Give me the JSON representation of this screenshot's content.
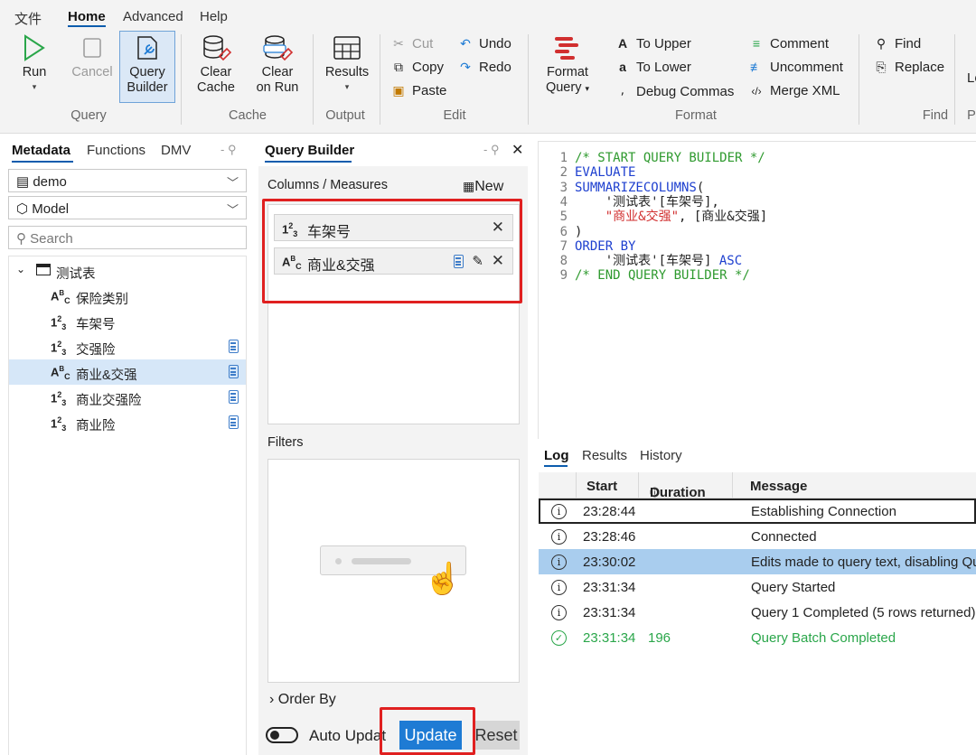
{
  "menubar": {
    "file": "文件",
    "home": "Home",
    "advanced": "Advanced",
    "help": "Help"
  },
  "ribbon": {
    "run": "Run",
    "cancel": "Cancel",
    "query_builder_l1": "Query",
    "query_builder_l2": "Builder",
    "clear_cache_l1": "Clear",
    "clear_cache_l2": "Cache",
    "clear_on_run_l1": "Clear",
    "clear_on_run_l2": "on Run",
    "results": "Results",
    "cut": "Cut",
    "copy": "Copy",
    "paste": "Paste",
    "undo": "Undo",
    "redo": "Redo",
    "format_query_l1": "Format",
    "format_query_l2": "Query",
    "to_upper": "To Upper",
    "to_lower": "To Lower",
    "debug_commas": "Debug Commas",
    "comment": "Comment",
    "uncomment": "Uncomment",
    "merge_xml": "Merge XML",
    "find": "Find",
    "replace": "Replace",
    "cut_off": "Lo",
    "groups": {
      "query": "Query",
      "cache": "Cache",
      "output": "Output",
      "edit": "Edit",
      "format": "Format",
      "find": "Find",
      "cut_off": "P"
    }
  },
  "metadata": {
    "tabs": [
      "Metadata",
      "Functions",
      "DMV"
    ],
    "database": "demo",
    "model": "Model",
    "search_placeholder": "Search",
    "table": "测试表",
    "columns": [
      {
        "type": "ABC",
        "name": "保险类别",
        "calc": false
      },
      {
        "type": "123",
        "name": "车架号",
        "calc": false
      },
      {
        "type": "123",
        "name": "交强险",
        "calc": true
      },
      {
        "type": "ABC",
        "name": "商业&交强",
        "calc": true,
        "selected": true
      },
      {
        "type": "123",
        "name": "商业交强险",
        "calc": true
      },
      {
        "type": "123",
        "name": "商业险",
        "calc": true
      }
    ]
  },
  "query_builder": {
    "title": "Query Builder",
    "columns_label": "Columns / Measures",
    "new_label": "New",
    "items": [
      {
        "type": "123",
        "name": "车架号"
      },
      {
        "type": "ABC",
        "name": "商业&交强"
      }
    ],
    "filters_label": "Filters",
    "order_by_label": "Order By",
    "auto_update_label": "Auto Updat",
    "update_label": "Update",
    "reset_label": "Reset"
  },
  "editor": {
    "line_numbers": [
      "1",
      "2",
      "3",
      "4",
      "5",
      "6",
      "7",
      "8",
      "9"
    ]
  },
  "log": {
    "tabs": [
      "Log",
      "Results",
      "History"
    ],
    "headers": {
      "start": "Start",
      "duration": "Duration",
      "message": "Message"
    },
    "rows": [
      {
        "start": "23:28:44",
        "duration": "",
        "message": "Establishing Connection"
      },
      {
        "start": "23:28:46",
        "duration": "",
        "message": "Connected"
      },
      {
        "start": "23:30:02",
        "duration": "",
        "message": "Edits made to query text, disabling Qu"
      },
      {
        "start": "23:31:34",
        "duration": "",
        "message": "Query Started"
      },
      {
        "start": "23:31:34",
        "duration": "",
        "message": "Query 1 Completed (5 rows returned)"
      },
      {
        "start": "23:31:34",
        "duration": "196",
        "message": "Query Batch Completed"
      }
    ]
  },
  "colors": {
    "accent": "#0b5cad",
    "highlight_red": "#e02020",
    "selection": "#a9cdee",
    "success": "#2aa64a",
    "update_button": "#1e7bd4"
  }
}
